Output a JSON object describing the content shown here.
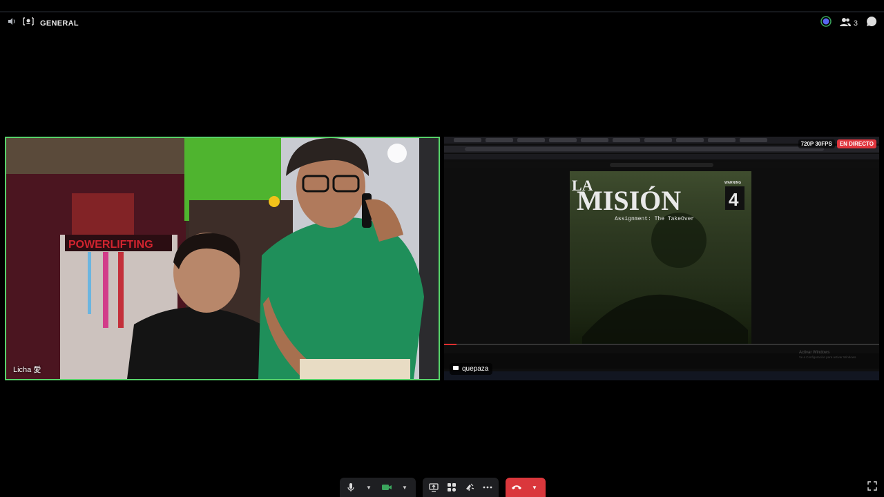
{
  "header": {
    "channel_name": "GENERAL",
    "participant_count": "3"
  },
  "tiles": {
    "camera": {
      "name": "Licha 愛"
    },
    "stream": {
      "name": "quepaza",
      "quality": "720P 30FPS",
      "live": "EN DIRECTO",
      "video_title_main": "MISIÓN",
      "video_title_prefix": "LA",
      "video_title_number": "4",
      "video_subtitle": "Assignment: The TakeOver",
      "warning": "WARNING",
      "windows_watermark_1": "Activar Windows",
      "windows_watermark_2": "Ve a Configuración para activar Windows."
    }
  },
  "colors": {
    "speaking_border": "#57d26a",
    "live_badge": "#e0353d",
    "end_call": "#da373c",
    "toolbar_bg": "#1e1f22"
  },
  "icons": {
    "volume": "speaker-icon",
    "stage": "stage-channel-icon",
    "activity": "activity-icon",
    "participants": "people-icon",
    "chat": "chat-bubble-icon",
    "mic": "microphone-icon",
    "camera": "video-camera-icon",
    "screenshare": "screen-share-icon",
    "activities": "activities-icon",
    "soundboard": "soundboard-icon",
    "more": "more-dots-icon",
    "hangup": "phone-hangup-icon",
    "fullscreen": "fullscreen-icon"
  }
}
